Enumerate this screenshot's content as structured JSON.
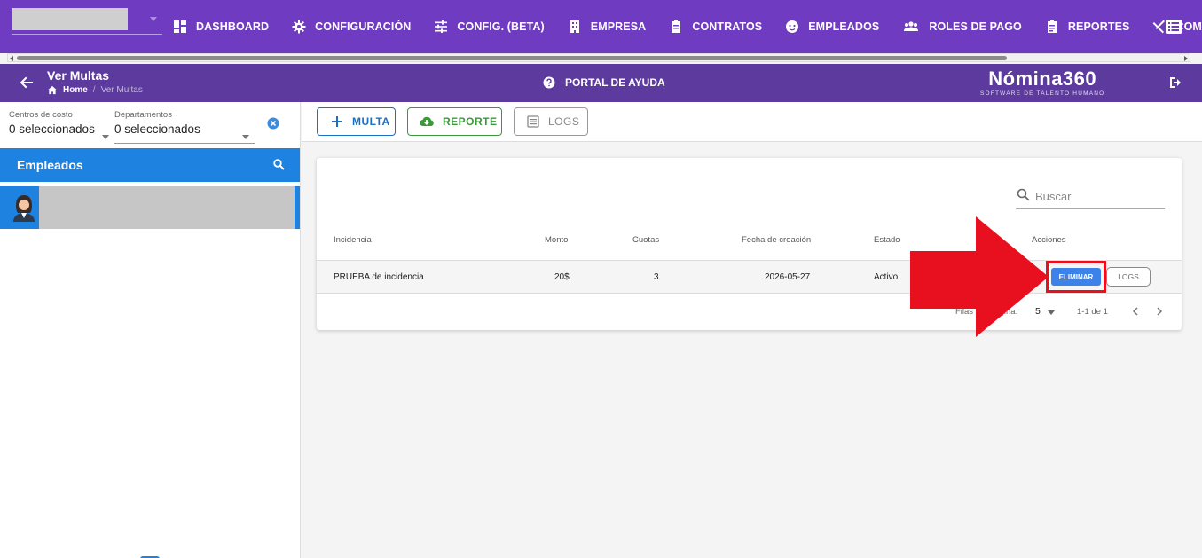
{
  "nav": {
    "items": [
      {
        "label": "DASHBOARD",
        "icon": "dashboard-icon"
      },
      {
        "label": "CONFIGURACIÓN",
        "icon": "gear-icon"
      },
      {
        "label": "CONFIG. (BETA)",
        "icon": "sliders-icon"
      },
      {
        "label": "EMPRESA",
        "icon": "building-icon"
      },
      {
        "label": "CONTRATOS",
        "icon": "clipboard-icon"
      },
      {
        "label": "EMPLEADOS",
        "icon": "face-icon"
      },
      {
        "label": "ROLES DE PAGO",
        "icon": "group-icon"
      },
      {
        "label": "REPORTES",
        "icon": "report-icon"
      },
      {
        "label": "COMEDOR",
        "icon": "cutlery-icon"
      }
    ]
  },
  "subheader": {
    "title": "Ver Multas",
    "breadcrumb_home": "Home",
    "breadcrumb_sep": "/",
    "breadcrumb_current": "Ver Multas",
    "help_label": "PORTAL DE AYUDA",
    "logo_brand": "Nómina360",
    "logo_tagline": "SOFTWARE DE TALENTO HUMANO"
  },
  "filters": {
    "cost_centers_label": "Centros de costo",
    "cost_centers_value": "0 seleccionados",
    "departments_label": "Departamentos",
    "departments_value": "0 seleccionados"
  },
  "employees": {
    "header": "Empleados"
  },
  "toolbar": {
    "multa_label": "MULTA",
    "reporte_label": "REPORTE",
    "logs_label": "LOGS"
  },
  "table": {
    "search_placeholder": "Buscar",
    "columns": {
      "incidencia": "Incidencia",
      "monto": "Monto",
      "cuotas": "Cuotas",
      "fecha": "Fecha de creación",
      "estado": "Estado",
      "acciones": "Acciones"
    },
    "rows": [
      {
        "incidencia": "PRUEBA de incidencia",
        "monto": "20$",
        "cuotas": "3",
        "fecha": "2026-05-27",
        "estado": "Activo",
        "eliminar_label": "ELIMINAR",
        "logs_label": "LOGS"
      }
    ],
    "footer": {
      "rows_per_page_label": "Filas por página:",
      "rows_per_page_value": "5",
      "range": "1-1 de 1"
    }
  },
  "colors": {
    "nav_bg": "#6f3bc0",
    "subheader_bg": "#5d3a9e",
    "accent_blue": "#1d82e0",
    "arrow_red": "#e8101e"
  }
}
